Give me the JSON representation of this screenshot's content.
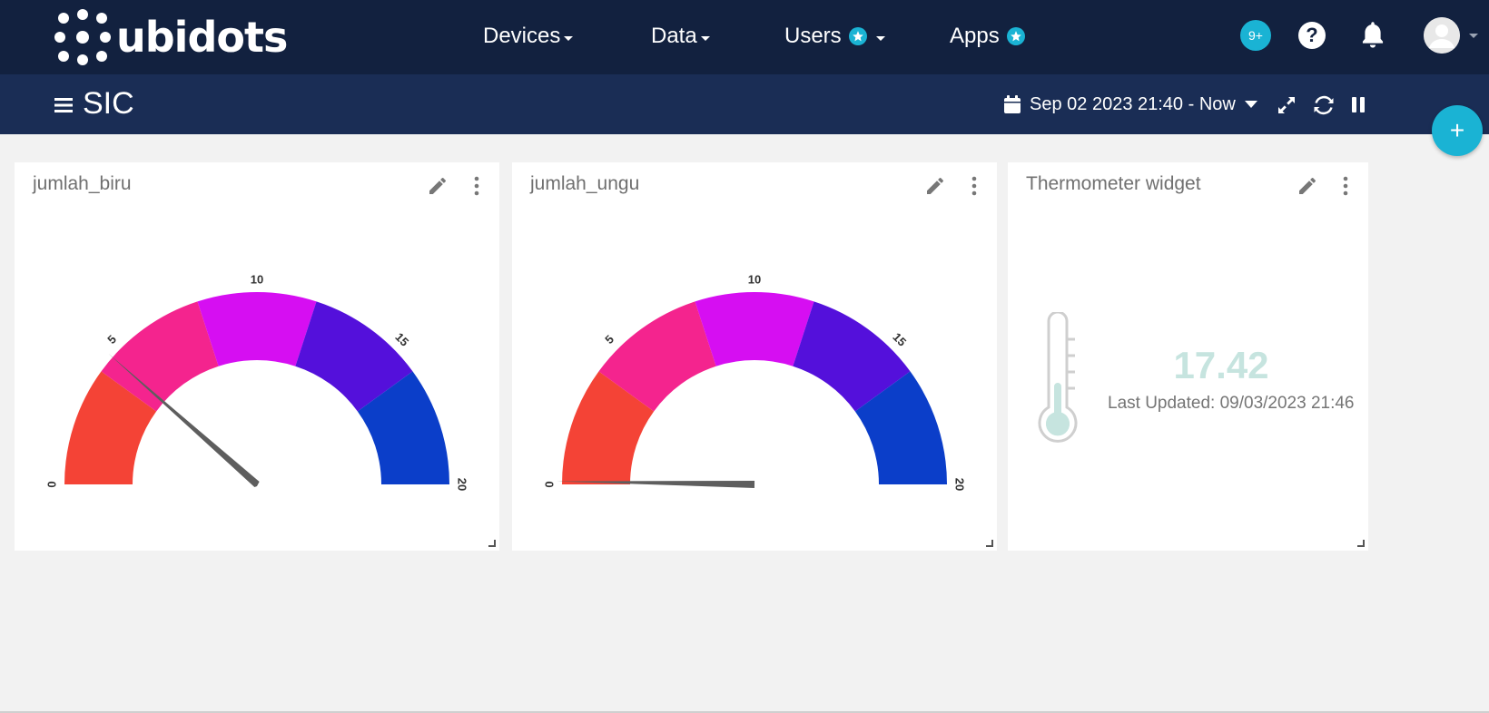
{
  "brand": {
    "logo_text": "ubidots"
  },
  "nav": {
    "items": [
      {
        "label": "Devices"
      },
      {
        "label": "Data"
      },
      {
        "label": "Users"
      },
      {
        "label": "Apps"
      }
    ],
    "notifications_count": "9+",
    "help_label": "?"
  },
  "subbar": {
    "dashboard_title": "SIC",
    "date_range": "Sep 02 2023 21:40 - Now"
  },
  "fab_label": "+",
  "widgets": [
    {
      "title": "jumlah_biru",
      "type": "gauge",
      "min": 0,
      "max": 20,
      "value": 4.6,
      "ticks": [
        "0",
        "5",
        "10",
        "15",
        "20"
      ],
      "band_colors": [
        "#f44336",
        "#f4248e",
        "#d60ef2",
        "#5410db",
        "#0b3ec9"
      ]
    },
    {
      "title": "jumlah_ungu",
      "type": "gauge",
      "min": 0,
      "max": 20,
      "value": 0.1,
      "ticks": [
        "0",
        "5",
        "10",
        "15",
        "20"
      ],
      "band_colors": [
        "#f44336",
        "#f4248e",
        "#d60ef2",
        "#5410db",
        "#0b3ec9"
      ]
    },
    {
      "title": "Thermometer widget",
      "type": "thermometer",
      "value": "17.42",
      "last_updated": "Last Updated: 09/03/2023 21:46",
      "accent_color": "#c6e4df"
    }
  ],
  "colors": {
    "topbar": "#12213f",
    "subbar": "#1a2d55",
    "accent": "#1ab3d4",
    "background": "#f2f2f2"
  }
}
